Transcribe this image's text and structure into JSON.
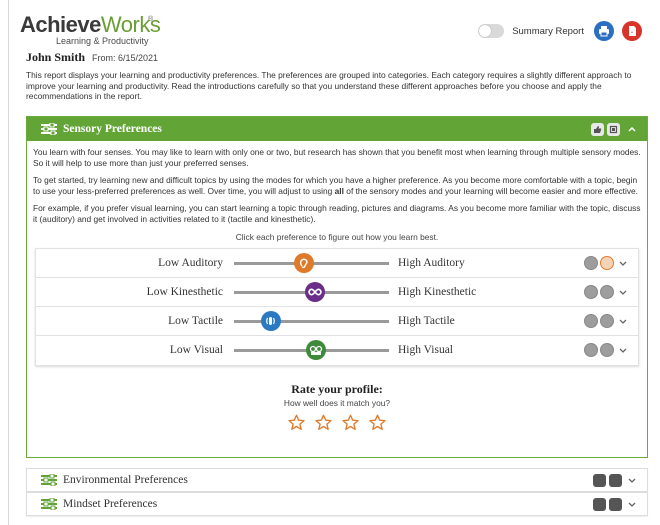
{
  "brand": {
    "name_a": "Achieve",
    "name_b": "Works",
    "tm": "®",
    "tagline": "Learning & Productivity"
  },
  "header": {
    "student_name": "John Smith",
    "date_text": "From: 6/15/2021",
    "summary_label": "Summary Report"
  },
  "intro": "This report displays your learning and productivity preferences. The preferences are grouped into categories. Each category requires a slightly different approach to improve your learning and productivity. Read the introductions carefully so that you understand these different approaches before you choose and apply the recommendations in the report.",
  "sensory": {
    "title": "Sensory Preferences",
    "para1": "You learn with four senses. You may like to learn with only one or two, but research has shown that you benefit most when learning through multiple sensory modes. So it will help to use more than just your preferred senses.",
    "para2_a": "To get started, try learning new and difficult topics by using the modes for which you have a higher preference. As you become more comfortable with a topic, begin to use your less-preferred preferences as well. Over time, you will adjust to using ",
    "para2_bold": "all",
    "para2_b": " of the sensory modes and your learning will become easier and more effective.",
    "para3": "For example, if you prefer visual learning, you can start learning a topic through reading, pictures and diagrams. As you become more familiar with the topic, discuss it (auditory) and get involved in activities related to it (tactile and kinesthetic).",
    "hint": "Click each preference to figure out how you learn best.",
    "prefs": [
      {
        "low": "Low Auditory",
        "high": "High Auditory",
        "level": 0.45,
        "knob_color": "#e07a2b",
        "icon": "ear-icon"
      },
      {
        "low": "Low Kinesthetic",
        "high": "High Kinesthetic",
        "level": 0.52,
        "knob_color": "#6b2d8a",
        "icon": "infinity-icon"
      },
      {
        "low": "Low Tactile",
        "high": "High Tactile",
        "level": 0.24,
        "knob_color": "#2b79c2",
        "icon": "touch-icon"
      },
      {
        "low": "Low Visual",
        "high": "High Visual",
        "level": 0.53,
        "knob_color": "#3f8a3a",
        "icon": "eye-icon"
      }
    ],
    "rate_title": "Rate your profile:",
    "rate_sub": "How well does it match you?",
    "stars": 4
  },
  "environmental": {
    "title": "Environmental Preferences"
  },
  "mindset": {
    "title": "Mindset Preferences"
  },
  "colors": {
    "accent_green": "#62a536",
    "star_orange": "#e07a2b"
  }
}
